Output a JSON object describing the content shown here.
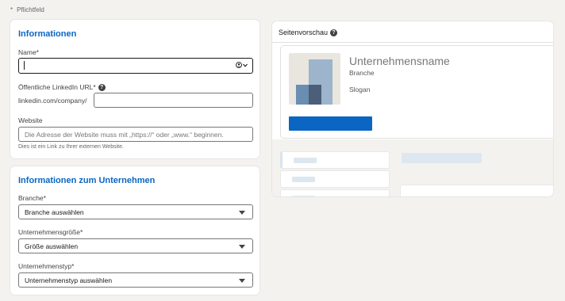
{
  "required_note": {
    "star": "*",
    "text": "Pflichtfeld"
  },
  "info_section": {
    "title": "Informationen",
    "name_label": "Name*",
    "name_value": "",
    "linkedin_label": "Öffentliche LinkedIn URL*",
    "linkedin_prefix": "linkedin.com/company/",
    "linkedin_value": "",
    "website_label": "Website",
    "website_placeholder": "Die Adresse der Website muss mit „https://“ oder „www.“ beginnen.",
    "website_hint": "Dies ist ein Link zu Ihrer externen Website."
  },
  "company_section": {
    "title": "Informationen zum Unternehmen",
    "branche_label": "Branche*",
    "branche_value": "Branche auswählen",
    "size_label": "Unternehmensgröße*",
    "size_value": "Größe auswählen",
    "type_label": "Unternehmenstyp*",
    "type_value": "Unternehmenstyp auswählen"
  },
  "preview": {
    "title": "Seitenvorschau",
    "company_name": "Unternehmensname",
    "branche": "Branche",
    "slogan": "Slogan"
  },
  "colors": {
    "accent": "#0a66c2",
    "background": "#f3f2ef",
    "skeleton": "#dde7f0"
  },
  "icons": {
    "help": "question-circle-icon",
    "identity": "person-visibility-icon",
    "dropdown": "caret-down-icon"
  }
}
